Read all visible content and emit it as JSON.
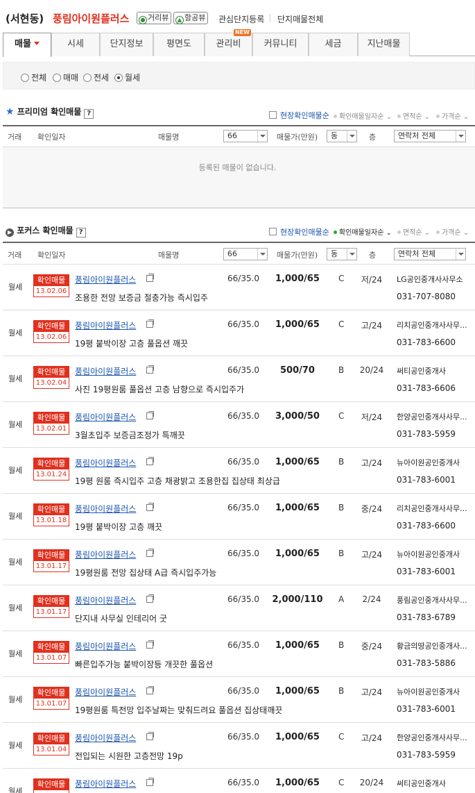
{
  "header": {
    "location": "(서현동)",
    "complex_name": "풍림아이원플러스",
    "street_view_label": "거리뷰",
    "aerial_view_label": "항공뷰",
    "link_register": "관심단지등록",
    "link_all_listings": "단지매물전체"
  },
  "tabs": [
    {
      "label": "매물",
      "active": true
    },
    {
      "label": "시세"
    },
    {
      "label": "단지정보"
    },
    {
      "label": "평면도"
    },
    {
      "label": "관리비",
      "badge": "NEW"
    },
    {
      "label": "커뮤니티"
    },
    {
      "label": "세금"
    },
    {
      "label": "지난매물"
    }
  ],
  "trade_filter": {
    "options": [
      "전체",
      "매매",
      "전세",
      "월세"
    ],
    "selected": "월세"
  },
  "premium": {
    "title": "프리미엄 확인매물",
    "help": "?",
    "onsite_checkbox": "현장확인매물순",
    "sort": [
      "확인매물일자순",
      "면적순",
      "가격순"
    ],
    "columns": {
      "type": "거래",
      "date": "확인일자",
      "name": "매물명",
      "area_select": "66",
      "price": "매물가(만원)",
      "dong_select": "동",
      "floor": "층",
      "contact_select": "연락처 전체"
    },
    "empty_message": "등록된 매물이 없습니다."
  },
  "focus": {
    "title": "포커스 확인매물",
    "help": "?",
    "onsite_checkbox": "현장확인매물순",
    "sort": [
      "확인매물일자순",
      "면적순",
      "가격순"
    ],
    "columns": {
      "type": "거래",
      "date": "확인일자",
      "name": "매물명",
      "area_select": "66",
      "price": "매물가(만원)",
      "dong_select": "동",
      "floor": "층",
      "contact_select": "연락처 전체"
    },
    "badge_label": "확인매물",
    "listings": [
      {
        "type": "월세",
        "date": "13.02.06",
        "name": "풍림아이원플러스",
        "desc": "조용한 전망 보증금 절충가능 즉시입주",
        "area": "66/35.0",
        "price": "1,000/65",
        "dong": "C",
        "floor": "저/24",
        "agency": "LG공인중개사사무소",
        "phone": "031-707-8080"
      },
      {
        "type": "월세",
        "date": "13.02.06",
        "name": "풍림아이원플러스",
        "desc": "19평 붙박이장 고층 풀옵션 깨끗",
        "area": "66/35.0",
        "price": "1,000/65",
        "dong": "C",
        "floor": "고/24",
        "agency": "리치공인중개사사무...",
        "phone": "031-783-6600"
      },
      {
        "type": "월세",
        "date": "13.02.04",
        "name": "풍림아이원플러스",
        "desc": "사진 19평원룸 풀옵션 고층 남향으로 즉시입주가",
        "area": "66/35.0",
        "price": "500/70",
        "dong": "B",
        "floor": "20/24",
        "agency": "써티공인중개사",
        "phone": "031-783-6606"
      },
      {
        "type": "월세",
        "date": "13.02.01",
        "name": "풍림아이원플러스",
        "desc": "3월초입주 보증금조정가 특깨끗",
        "area": "66/35.0",
        "price": "3,000/50",
        "dong": "C",
        "floor": "저/24",
        "agency": "한양공인중개사사무...",
        "phone": "031-783-5959"
      },
      {
        "type": "월세",
        "date": "13.01.24",
        "name": "풍림아이원플러스",
        "desc": "19평 원룸 즉시입주 고층 채광밝고 조용한집 집상태 최상급",
        "area": "66/35.0",
        "price": "1,000/65",
        "dong": "B",
        "floor": "고/24",
        "agency": "뉴아이원공인중개사",
        "phone": "031-783-6001"
      },
      {
        "type": "월세",
        "date": "13.01.18",
        "name": "풍림아이원플러스",
        "desc": "19평 붙박이장 고층 깨끗",
        "area": "66/35.0",
        "price": "1,000/65",
        "dong": "B",
        "floor": "중/24",
        "agency": "리치공인중개사사무...",
        "phone": "031-783-6600"
      },
      {
        "type": "월세",
        "date": "13.01.17",
        "name": "풍림아이원플러스",
        "desc": "19평원룸 전망 집상태 A급 즉시입주가능",
        "area": "66/35.0",
        "price": "1,000/65",
        "dong": "B",
        "floor": "고/24",
        "agency": "뉴아이원공인중개사",
        "phone": "031-783-6001"
      },
      {
        "type": "월세",
        "date": "13.01.17",
        "name": "풍림아이원플러스",
        "desc": "단지내 사무실 인테리어 굿",
        "area": "66/35.0",
        "price": "2,000/110",
        "dong": "A",
        "floor": "2/24",
        "agency": "풍림공인중개사사무...",
        "phone": "031-783-6789"
      },
      {
        "type": "월세",
        "date": "13.01.07",
        "name": "풍림아이원플러스",
        "desc": "빠른입주가능 붙박이장등 개끗한 풀옵션",
        "area": "66/35.0",
        "price": "1,000/65",
        "dong": "B",
        "floor": "중/24",
        "agency": "황금의땅공인중개사...",
        "phone": "031-783-5886"
      },
      {
        "type": "월세",
        "date": "13.01.07",
        "name": "풍림아이원플러스",
        "desc": "19평원룸 특전망 입주날짜는 맞춰드려요 풀옵션 집상태깨끗",
        "area": "66/35.0",
        "price": "1,000/65",
        "dong": "B",
        "floor": "고/24",
        "agency": "뉴아이원공인중개사",
        "phone": "031-783-6001"
      },
      {
        "type": "월세",
        "date": "13.01.04",
        "name": "풍림아이원플러스",
        "desc": "전입되는 시원한 고층전망 19p",
        "area": "66/35.0",
        "price": "1,000/65",
        "dong": "C",
        "floor": "고/24",
        "agency": "한양공인중개사사무...",
        "phone": "031-783-5959"
      },
      {
        "type": "월세",
        "date": "",
        "name": "풍림아이원플러스",
        "desc": "",
        "area": "66/35.0",
        "price": "1,000/65",
        "dong": "C",
        "floor": "20/24",
        "agency": "써티공인중개사",
        "phone": ""
      }
    ]
  }
}
